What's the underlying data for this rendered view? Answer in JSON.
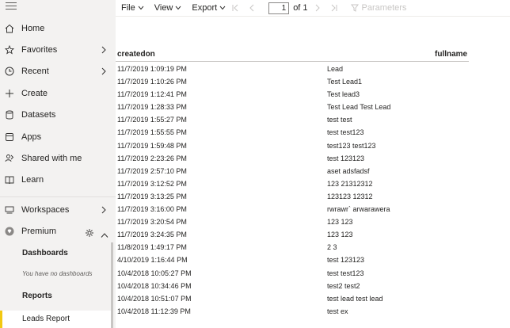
{
  "sidebar": {
    "items": [
      {
        "label": "Home",
        "icon": "home-icon",
        "chevron": false
      },
      {
        "label": "Favorites",
        "icon": "star-icon",
        "chevron": true
      },
      {
        "label": "Recent",
        "icon": "clock-icon",
        "chevron": true
      },
      {
        "label": "Create",
        "icon": "plus-icon",
        "chevron": false
      },
      {
        "label": "Datasets",
        "icon": "database-icon",
        "chevron": false
      },
      {
        "label": "Apps",
        "icon": "apps-icon",
        "chevron": false
      },
      {
        "label": "Shared with me",
        "icon": "shared-users-icon",
        "chevron": false
      },
      {
        "label": "Learn",
        "icon": "book-icon",
        "chevron": false
      }
    ],
    "workspaces_label": "Workspaces",
    "premium_label": "Premium",
    "dashboards_heading": "Dashboards",
    "no_dashboards_text": "You have no dashboards",
    "reports_heading": "Reports",
    "active_report": "Leads Report",
    "active_accent_color": "#f2c811"
  },
  "toolbar": {
    "file_label": "File",
    "view_label": "View",
    "export_label": "Export",
    "page_current": "1",
    "page_of": "of 1",
    "parameters_label": "Parameters"
  },
  "report": {
    "columns": [
      "createdon",
      "fullname"
    ],
    "rows": [
      [
        "11/7/2019 1:09:19 PM",
        "Lead"
      ],
      [
        "11/7/2019 1:10:26 PM",
        "Test Lead1"
      ],
      [
        "11/7/2019 1:12:41 PM",
        "Test lead3"
      ],
      [
        "11/7/2019 1:28:33 PM",
        "Test Lead Test Lead"
      ],
      [
        "11/7/2019 1:55:27 PM",
        "test test"
      ],
      [
        "11/7/2019 1:55:55 PM",
        "test test123"
      ],
      [
        "11/7/2019 1:59:48 PM",
        "test123 test123"
      ],
      [
        "11/7/2019 2:23:26 PM",
        "test 123123"
      ],
      [
        "11/7/2019 2:57:10 PM",
        "aset adsfadsf"
      ],
      [
        "11/7/2019 3:12:52 PM",
        "123 21312312"
      ],
      [
        "11/7/2019 3:13:25 PM",
        "123123 12312"
      ],
      [
        "11/7/2019 3:16:00 PM",
        "rwrawr` arwarawera"
      ],
      [
        "11/7/2019 3:20:54 PM",
        "123 123"
      ],
      [
        "11/7/2019 3:24:35 PM",
        "123 123"
      ],
      [
        "11/8/2019 1:49:17 PM",
        "2 3"
      ],
      [
        "4/10/2019 1:16:44 PM",
        "test 123123"
      ],
      [
        "10/4/2018 10:05:27 PM",
        "test test123"
      ],
      [
        "10/4/2018 10:34:46 PM",
        "test2 test2"
      ],
      [
        "10/4/2018 10:51:07 PM",
        "test lead test lead"
      ],
      [
        "10/4/2018 11:12:39 PM",
        "test ex"
      ]
    ]
  }
}
